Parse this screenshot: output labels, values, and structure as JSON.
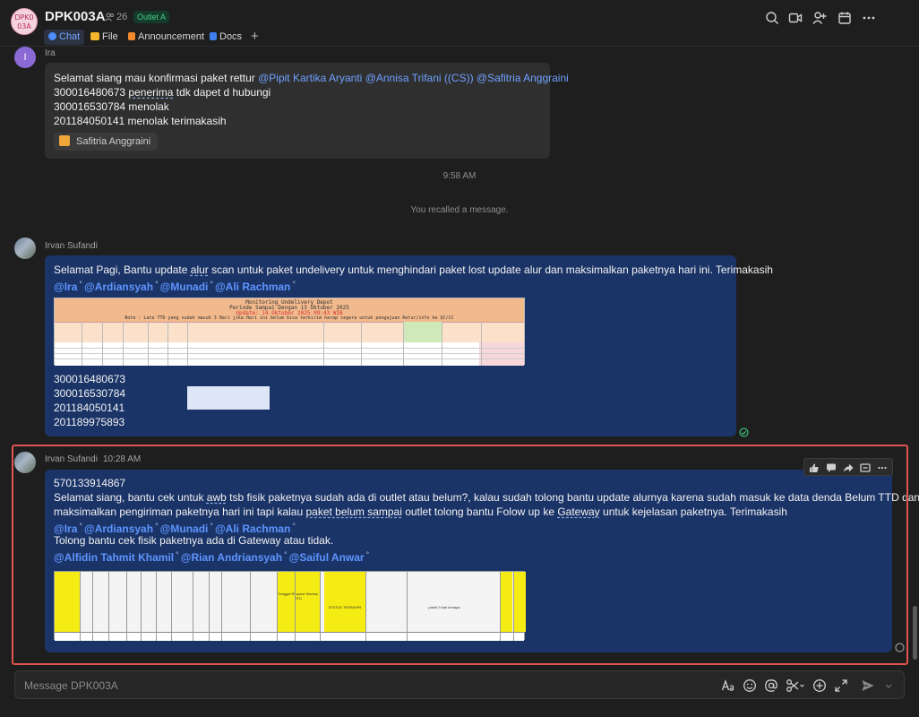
{
  "header": {
    "avatar_text": "DPK0\n03A",
    "avatar_line1": "DPK0",
    "avatar_line2": "03A",
    "title": "DPK003A",
    "member_count": "26",
    "badge": "Outlet A",
    "tabs": [
      {
        "label": "Chat",
        "icon": "chat-icon",
        "active": true
      },
      {
        "label": "File",
        "icon": "folder-icon",
        "active": false
      },
      {
        "label": "Announcement",
        "icon": "megaphone-icon",
        "active": false
      },
      {
        "label": "Docs",
        "icon": "docs-icon",
        "active": false
      }
    ],
    "add_tab": "+",
    "actions": [
      "search-icon",
      "video-call-icon",
      "add-member-icon",
      "calendar-icon",
      "more-icon"
    ]
  },
  "messages": {
    "m1": {
      "avatar_letter": "I",
      "sender": "Ira",
      "line1_text": "Selamat siang mau konfirmasi paket rettur ",
      "line1_mentions": [
        "@Pipit Kartika Aryanti",
        "@Annisa Trifani ((CS))",
        "@Safitria Anggraini"
      ],
      "line2_a": "300016480673 ",
      "line2_b": "penerima",
      "line2_c": " tdk dapet d hubungi",
      "line3": "300016530784 menolak",
      "line4": "201184050141 menolak terimakasih",
      "reaction_user": "Safitria Anggraini"
    },
    "time_divider": "9:58 AM",
    "recalled": "You recalled a message.",
    "m2": {
      "sender": "Irvan Sufandi",
      "line1_a": "Selamat Pagi, Bantu update ",
      "line1_b": "alur",
      "line1_c": " scan untuk paket undelivery untuk menghindari paket lost update alur dan maksimalkan paketnya hari ini. Terimakasih",
      "mentions": [
        "@Ira",
        "@Ardiansyah",
        "@Munadi",
        "@Ali Rachman"
      ],
      "sheet_title1": "Monitoring Undelivery Depot",
      "sheet_title2": "Periode Sampai Dengan 13 Oktober 2025",
      "sheet_update": "Update: 14 Oktober 2025 09:43 WIB",
      "sheet_note": "Note : Late TTD yang sudah masuk 3 Hari jika Hari ini belum bisa terkirim harap segera untuk pengajuan Retur/info ke QC/CC",
      "awbs": [
        "300016480673",
        "300016530784",
        "201184050141",
        "201189975893"
      ]
    },
    "m3": {
      "sender": "Irvan Sufandi",
      "time": "10:28 AM",
      "line1": "570133914867",
      "line2_a": "Selamat siang, bantu cek untuk ",
      "line2_b": "awb",
      "line2_c": " tsb fisik paketnya sudah ada di outlet atau belum?, kalau sudah tolong bantu update alurnya karena sudah masuk ke data denda Belum TTD dan",
      "line3_a": "maksimalkan pengiriman paketnya hari ini tapi kalau ",
      "line3_b": "paket belum sampai",
      "line3_c": " outlet tolong bantu Folow up ke ",
      "line3_d": "Gateway",
      "line3_e": " untuk kejelasan paketnya. Terimakasih",
      "mentions1": [
        "@Ira",
        "@Ardiansyah",
        "@Munadi",
        "@Ali Rachman"
      ],
      "line5": "Tolong bantu cek fisik paketnya ada di Gateway atau tidak.",
      "mentions2": [
        "@Alfidin Tahmit Khamil",
        "@Rian Andriansyah",
        "@Saiful Anwar"
      ],
      "sheet_col_a": "Tanggal Request Wadrop STD",
      "sheet_col_b": "STATUS TERAKHIR",
      "sheet_col_c": "paket 3 hari kenapa"
    }
  },
  "message_actions": [
    "thumbs-up-icon",
    "reply-icon",
    "forward-icon",
    "pin-icon",
    "more-icon"
  ],
  "composer": {
    "placeholder": "Message DPK003A",
    "tools": [
      "text-format-icon",
      "emoji-icon",
      "mention-icon",
      "scissors-icon",
      "add-icon",
      "expand-icon",
      "send-icon"
    ]
  },
  "colors": {
    "accent": "#4e8cff",
    "selection": "#e05350",
    "bubble_blue": "#1b3468",
    "bubble_gray": "#2f2f2f"
  }
}
